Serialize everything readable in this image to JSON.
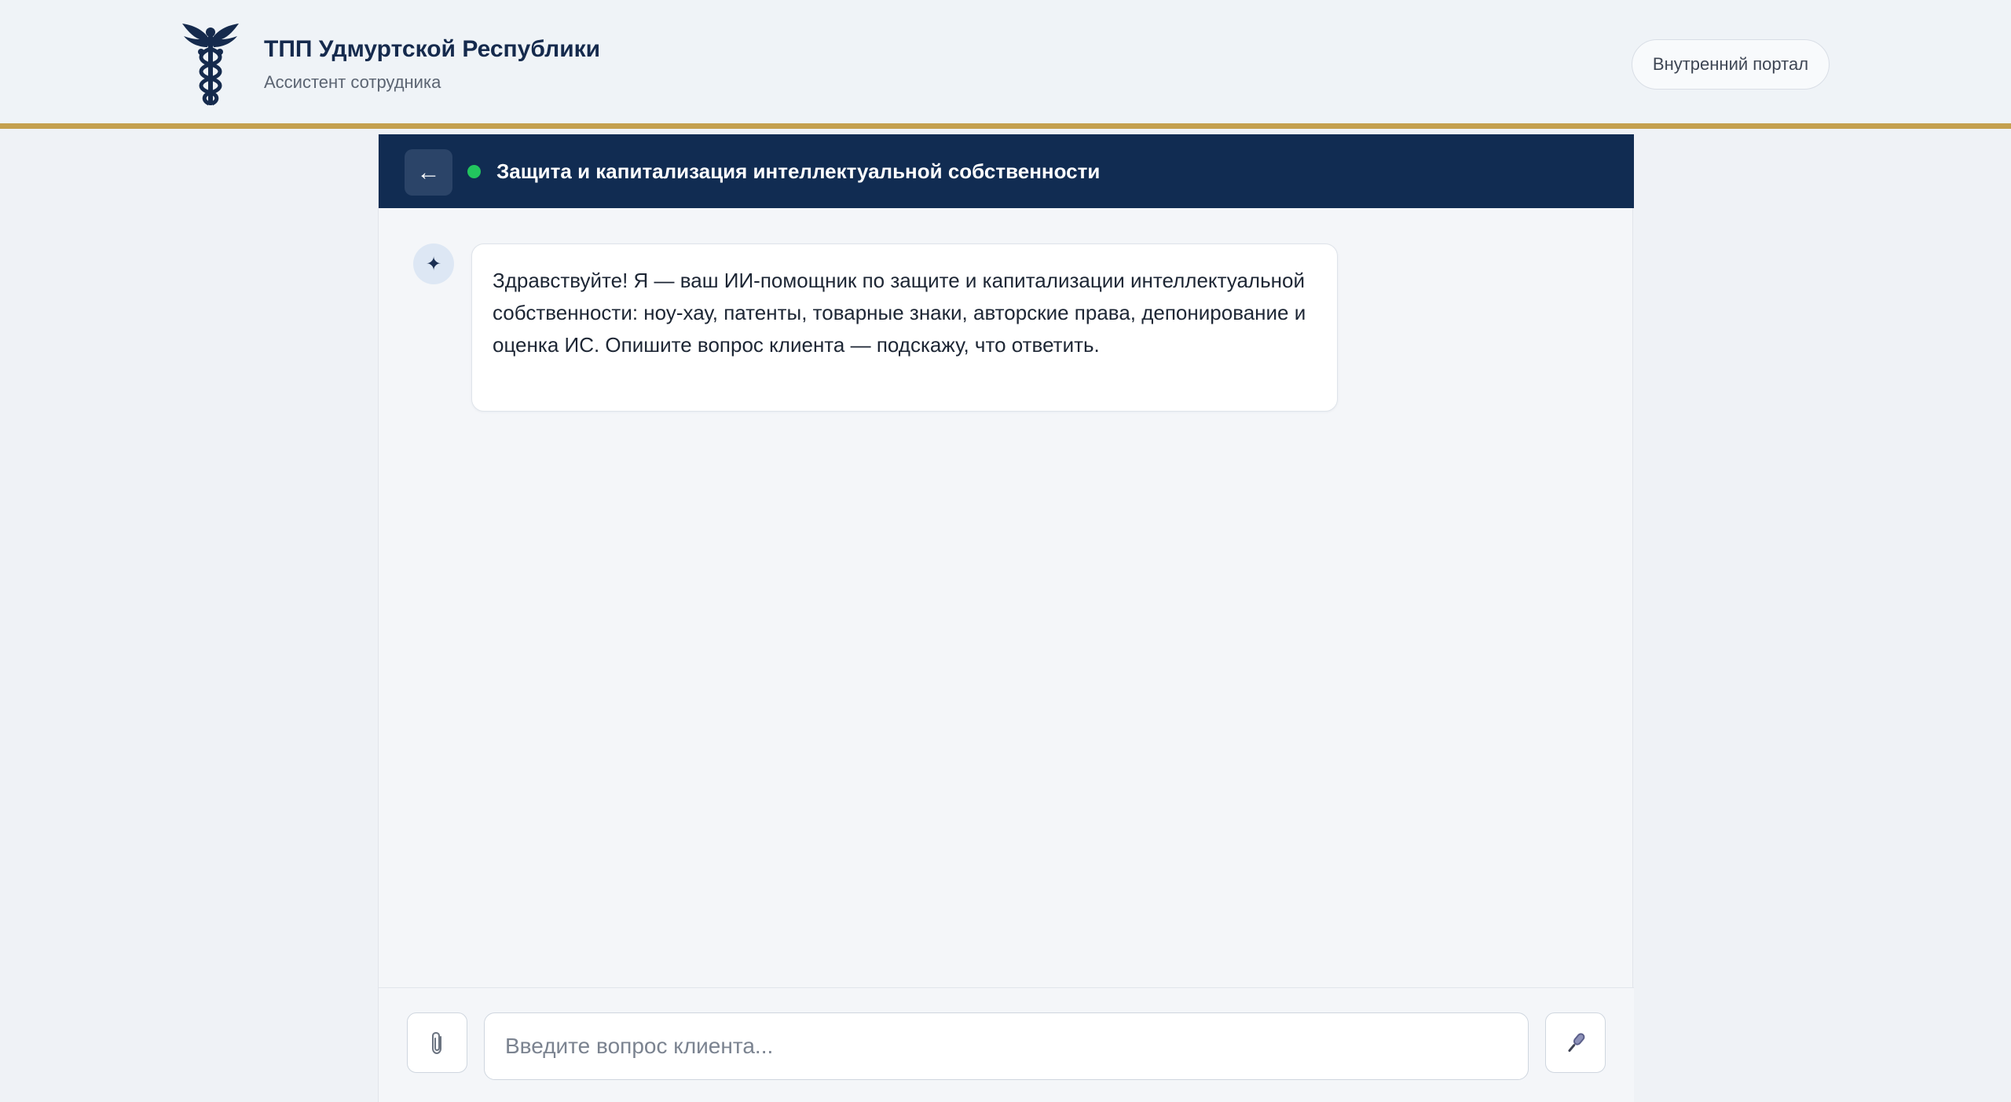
{
  "header": {
    "title": "ТПП Удмуртской Республики",
    "subtitle": "Ассистент сотрудника",
    "portal_button": "Внутренний портал",
    "logo_icon": "caduceus-icon"
  },
  "chat": {
    "back_label": "←",
    "status": "online",
    "status_color": "#22c55e",
    "title": "Защита и капитализация интеллектуальной собственности",
    "messages": [
      {
        "role": "assistant",
        "avatar": "✦",
        "text": "Здравствуйте! Я — ваш ИИ-помощник по защите и капитализации интеллектуальной собственности: ноу-хау, патенты, товарные знаки, авторские права, депонирование и оценка ИС. Опишите вопрос клиента — подскажу, что ответить."
      }
    ]
  },
  "composer": {
    "placeholder": "Введите вопрос клиента...",
    "value": "",
    "attach_icon": "paperclip-icon",
    "mic_icon": "microphone-icon"
  },
  "colors": {
    "navy": "#112c52",
    "gold": "#c4a04e",
    "background": "#eff2f6"
  }
}
